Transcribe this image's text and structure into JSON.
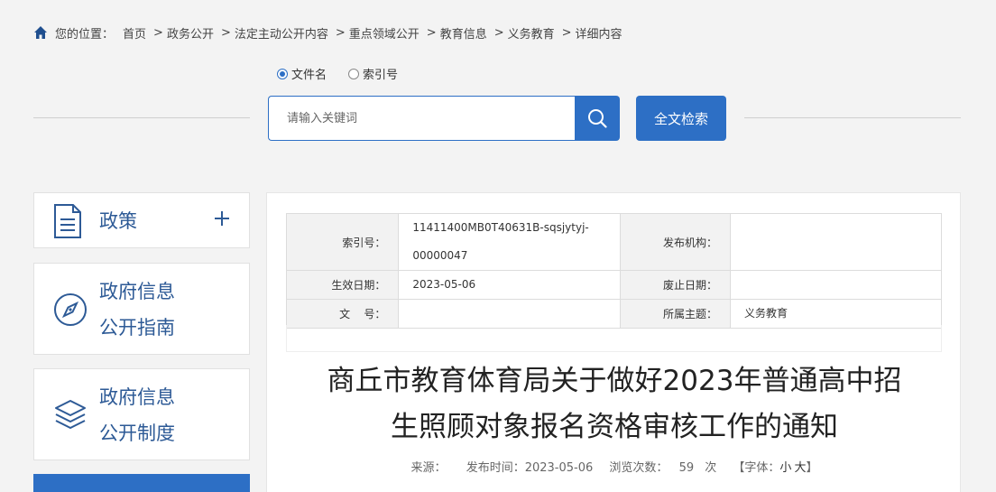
{
  "breadcrumb": {
    "prefix": "您的位置：",
    "items": [
      "首页",
      "政务公开",
      "法定主动公开内容",
      "重点领域公开",
      "教育信息",
      "义务教育",
      "详细内容"
    ]
  },
  "search": {
    "options": [
      "文件名",
      "索引号"
    ],
    "selected": "文件名",
    "placeholder": "请输入关键词",
    "fulltext_label": "全文检索"
  },
  "sidebar": {
    "items": [
      {
        "label": "政策",
        "icon": "document-icon"
      },
      {
        "label_line1": "政府信息",
        "label_line2": "公开指南",
        "icon": "compass-icon"
      },
      {
        "label_line1": "政府信息",
        "label_line2": "公开制度",
        "icon": "layers-icon"
      }
    ]
  },
  "meta": {
    "index_label": "索引号：",
    "index_value_1": "11411400MB0T40631B-sqsjytyj-",
    "index_value_2": "00000047",
    "publisher_label": "发布机构：",
    "publisher_value": "",
    "effective_label": "生效日期：",
    "effective_value": "2023-05-06",
    "expire_label": "废止日期：",
    "expire_value": "",
    "docno_label": "文    号：",
    "docno_value": "",
    "topic_label": "所属主题：",
    "topic_value": "义务教育"
  },
  "article": {
    "title_line1": "商丘市教育体育局关于做好2023年普通高中招",
    "title_line2": "生照顾对象报名资格审核工作的通知",
    "source_label": "来源：",
    "publish_label": "发布时间：",
    "publish_date": "2023-05-06",
    "views_label": "浏览次数：",
    "views_count": "59",
    "views_unit": "次",
    "font_label": "【字体：",
    "font_small": "小",
    "font_large": "大",
    "font_close": "】"
  },
  "colors": {
    "accent": "#2d6fc5",
    "sidebar_text": "#2d5a96"
  }
}
